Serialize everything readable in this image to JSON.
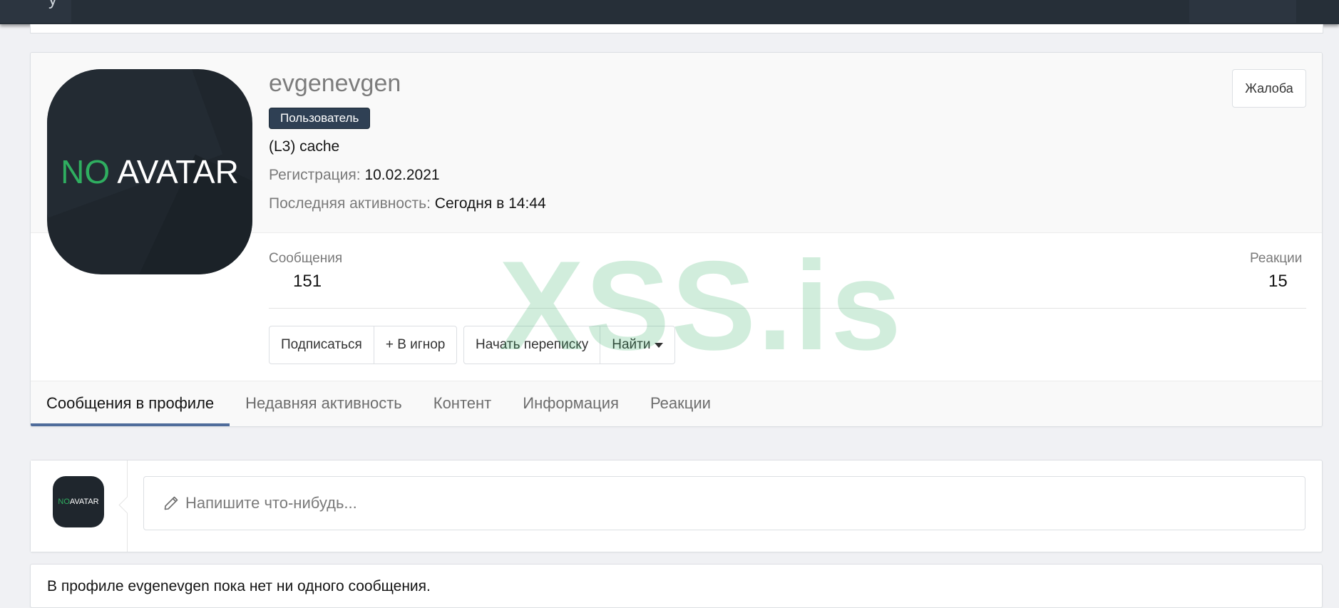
{
  "profile": {
    "username": "evgenevgen",
    "role": "Пользователь",
    "title": "(L3) cache",
    "registration_label": "Регистрация:",
    "registration_value": "10.02.2021",
    "last_activity_label": "Последняя активность:",
    "last_activity_value": "Сегодня в 14:44",
    "report_label": "Жалоба",
    "avatar_no": "NO",
    "avatar_avatar": "AVATAR"
  },
  "stats": {
    "messages_label": "Сообщения",
    "messages_value": "151",
    "reactions_label": "Реакции",
    "reactions_value": "15"
  },
  "actions": {
    "follow": "Подписаться",
    "ignore": "+ В игнор",
    "start_conversation": "Начать переписку",
    "find": "Найти"
  },
  "tabs": [
    {
      "label": "Сообщения в профиле",
      "active": true
    },
    {
      "label": "Недавняя активность",
      "active": false
    },
    {
      "label": "Контент",
      "active": false
    },
    {
      "label": "Информация",
      "active": false
    },
    {
      "label": "Реакции",
      "active": false
    }
  ],
  "watermark": "XSS.is",
  "post_box": {
    "placeholder": "Напишите что-нибудь...",
    "icon": "pencil-icon"
  },
  "empty_message": "В профиле evgenevgen пока нет ни одного сообщения.",
  "colors": {
    "topbar": "#262f38",
    "badge": "#2f4054",
    "tab_active_underline": "#4f6c9b",
    "watermark": "#2fae60"
  }
}
